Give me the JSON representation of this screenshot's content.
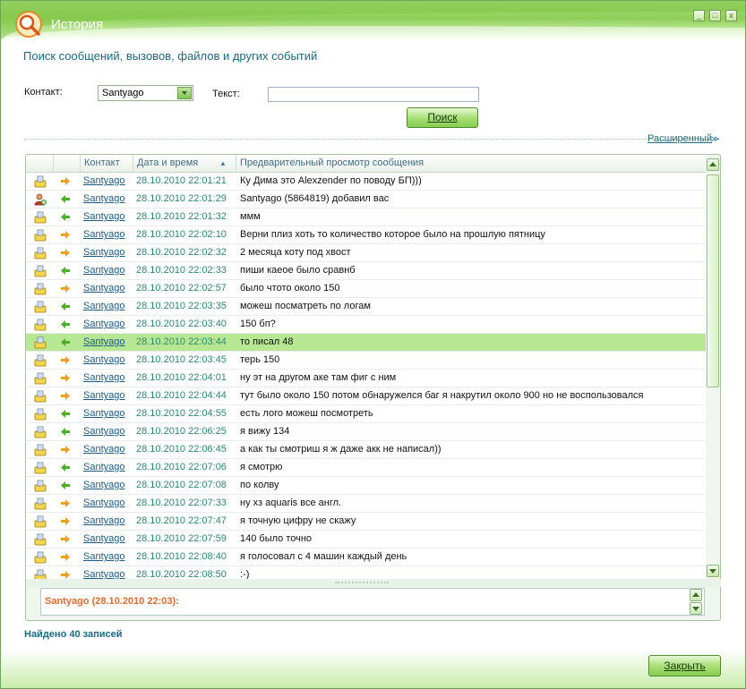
{
  "window": {
    "title": "История"
  },
  "header": {
    "text": "Поиск сообщений, вызовов, файлов и других событий"
  },
  "filters": {
    "contact_label": "Контакт:",
    "contact_value": "Santyago",
    "text_label": "Текст:",
    "text_value": "",
    "search_button": "Поиск",
    "advanced_link": "Расширенный"
  },
  "table": {
    "columns": [
      "",
      "",
      "Контакт",
      "Дата и время",
      "Предварительный просмотр сообщения"
    ],
    "sort_column": "Дата и время",
    "selected_index": 9,
    "rows": [
      {
        "icon": "envelope-icon",
        "dir": "out",
        "contact": "Santyago",
        "datetime": "28.10.2010 22:01:21",
        "message": "Ку Дима это Alexzender по поводу БП)))"
      },
      {
        "icon": "user-added-icon",
        "dir": "in",
        "contact": "Santyago",
        "datetime": "28.10.2010 22:01:29",
        "message": "Santyago (5864819) добавил вас"
      },
      {
        "icon": "envelope-icon",
        "dir": "in",
        "contact": "Santyago",
        "datetime": "28.10.2010 22:01:32",
        "message": "ммм"
      },
      {
        "icon": "envelope-icon",
        "dir": "out",
        "contact": "Santyago",
        "datetime": "28.10.2010 22:02:10",
        "message": "Верни плиз хоть то количество которое было на прошлую пятницу"
      },
      {
        "icon": "envelope-icon",
        "dir": "out",
        "contact": "Santyago",
        "datetime": "28.10.2010 22:02:32",
        "message": "2 месяца коту под хвост"
      },
      {
        "icon": "envelope-icon",
        "dir": "in",
        "contact": "Santyago",
        "datetime": "28.10.2010 22:02:33",
        "message": "пиши каеое было сравнб"
      },
      {
        "icon": "envelope-icon",
        "dir": "out",
        "contact": "Santyago",
        "datetime": "28.10.2010 22:02:57",
        "message": "было чтото около 150"
      },
      {
        "icon": "envelope-icon",
        "dir": "in",
        "contact": "Santyago",
        "datetime": "28.10.2010 22:03:35",
        "message": "можеш посматреть по логам"
      },
      {
        "icon": "envelope-icon",
        "dir": "in",
        "contact": "Santyago",
        "datetime": "28.10.2010 22:03:40",
        "message": "150 бп?"
      },
      {
        "icon": "envelope-icon",
        "dir": "in",
        "contact": "Santyago",
        "datetime": "28.10.2010 22:03:44",
        "message": "то писал 48"
      },
      {
        "icon": "envelope-icon",
        "dir": "out",
        "contact": "Santyago",
        "datetime": "28.10.2010 22:03:45",
        "message": "терь 150"
      },
      {
        "icon": "envelope-icon",
        "dir": "out",
        "contact": "Santyago",
        "datetime": "28.10.2010 22:04:01",
        "message": "ну эт на другом аке там фиг с ним"
      },
      {
        "icon": "envelope-icon",
        "dir": "out",
        "contact": "Santyago",
        "datetime": "28.10.2010 22:04:44",
        "message": "тут было около 150 потом обнаружелся баг я накрутил около 900 но не воспользовался"
      },
      {
        "icon": "envelope-icon",
        "dir": "in",
        "contact": "Santyago",
        "datetime": "28.10.2010 22:04:55",
        "message": "есть лого можеш посмотреть"
      },
      {
        "icon": "envelope-icon",
        "dir": "in",
        "contact": "Santyago",
        "datetime": "28.10.2010 22:06:25",
        "message": "я вижу 134"
      },
      {
        "icon": "envelope-icon",
        "dir": "out",
        "contact": "Santyago",
        "datetime": "28.10.2010 22:06:45",
        "message": "а как ты смотриш я ж даже акк не написал))"
      },
      {
        "icon": "envelope-icon",
        "dir": "in",
        "contact": "Santyago",
        "datetime": "28.10.2010 22:07:06",
        "message": "я смотрю"
      },
      {
        "icon": "envelope-icon",
        "dir": "in",
        "contact": "Santyago",
        "datetime": "28.10.2010 22:07:08",
        "message": "по колву"
      },
      {
        "icon": "envelope-icon",
        "dir": "out",
        "contact": "Santyago",
        "datetime": "28.10.2010 22:07:33",
        "message": "ну хз aquaris все англ."
      },
      {
        "icon": "envelope-icon",
        "dir": "out",
        "contact": "Santyago",
        "datetime": "28.10.2010 22:07:47",
        "message": "я точную цифру не скажу"
      },
      {
        "icon": "envelope-icon",
        "dir": "out",
        "contact": "Santyago",
        "datetime": "28.10.2010 22:07:59",
        "message": "140 было точно"
      },
      {
        "icon": "envelope-icon",
        "dir": "out",
        "contact": "Santyago",
        "datetime": "28.10.2010 22:08:40",
        "message": "я голосовал с 4 машин каждый день"
      },
      {
        "icon": "envelope-icon",
        "dir": "out",
        "contact": "Santyago",
        "datetime": "28.10.2010 22:08:50",
        "message": ":-)"
      }
    ]
  },
  "preview": {
    "header": "Santyago (28.10.2010 22:03):"
  },
  "footer": {
    "found_text": "Найдено 40 записей",
    "close_button": "Закрыть"
  },
  "colors": {
    "accent_green": "#8fcf58",
    "selected_row": "#b7e793",
    "link_blue": "#1a5c8a",
    "date_green": "#2a8a6f",
    "preview_orange": "#e26a2c",
    "out_arrow": "#f0a020",
    "in_arrow": "#4caf2a"
  }
}
